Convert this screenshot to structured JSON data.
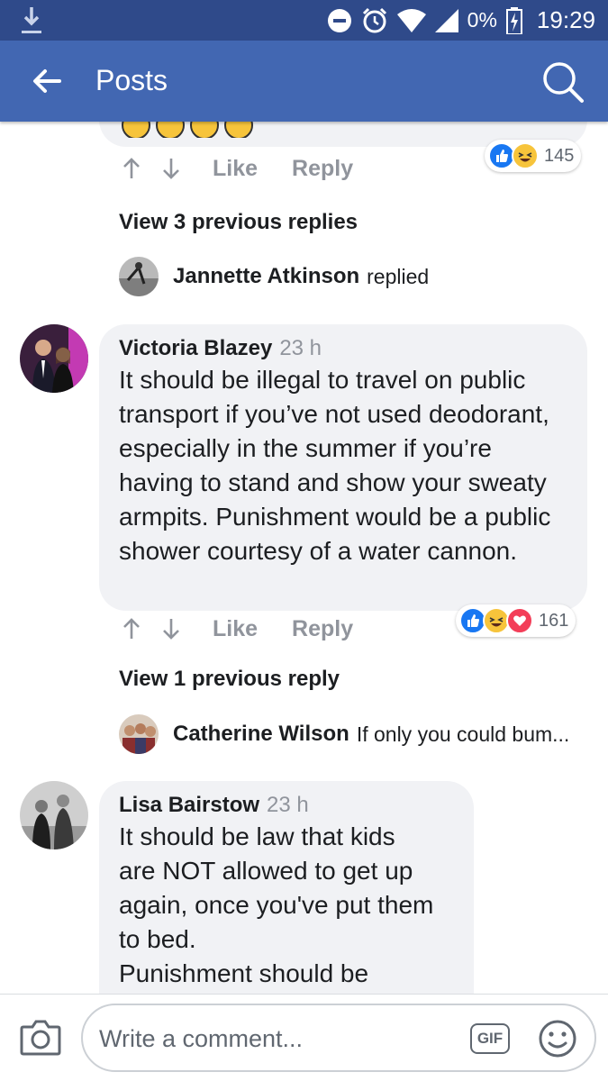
{
  "statusbar": {
    "battery": "0%",
    "time": "19:29"
  },
  "appbar": {
    "title": "Posts"
  },
  "colors": {
    "header": "#4267b2",
    "statusbar": "#2f4a8a",
    "like_blue": "#1877f2",
    "haha_yellow": "#f7c43b",
    "love_red": "#f33e58",
    "bubble": "#f1f2f5",
    "meta_grey": "#90949c"
  },
  "first_comment": {
    "actions": {
      "like": "Like",
      "reply": "Reply"
    },
    "reactions": {
      "icons": [
        "like-icon",
        "haha-icon"
      ],
      "count": "145"
    },
    "view_previous": "View 3 previous replies",
    "latest_reply": {
      "name": "Jannette Atkinson",
      "text": "replied"
    }
  },
  "comments": [
    {
      "name": "Victoria Blazey",
      "time": "23 h",
      "text": "It should be illegal to travel on public transport if you’ve not used deodorant, especially in the summer if you’re having to stand and show your sweaty armpits. Punishment would be a public shower courtesy of a water cannon.",
      "actions": {
        "like": "Like",
        "reply": "Reply"
      },
      "reactions": {
        "icons": [
          "like-icon",
          "haha-icon",
          "love-icon"
        ],
        "count": "161"
      },
      "view_previous": "View 1 previous reply",
      "latest_reply": {
        "name": "Catherine Wilson",
        "text": "If only you could bum..."
      }
    },
    {
      "name": "Lisa Bairstow",
      "time": "23 h",
      "text_lines": [
        "It should be law that kids",
        "are NOT allowed to get up",
        "again, once you've put them",
        "to bed.",
        "Punishment should be"
      ]
    }
  ],
  "composer": {
    "placeholder": "Write a comment...",
    "gif_label": "GIF"
  }
}
